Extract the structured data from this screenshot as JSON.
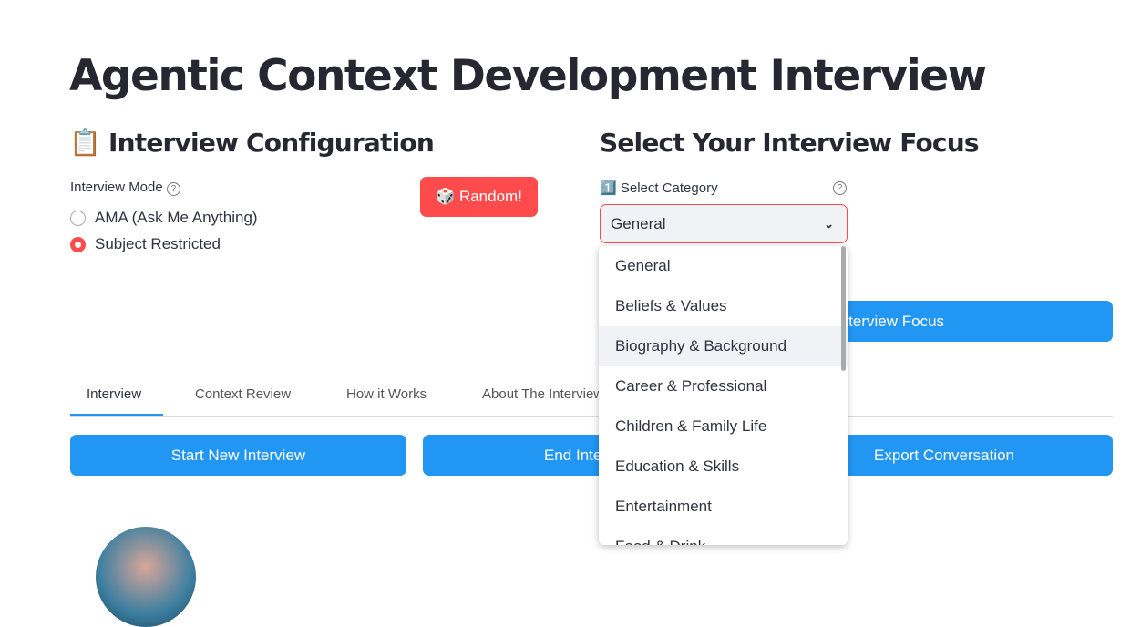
{
  "title": "Agentic Context Development Interview",
  "config": {
    "heading": "Interview Configuration",
    "heading_icon": "clipboard-icon",
    "mode_label": "Interview Mode",
    "modes": [
      "AMA (Ask Me Anything)",
      "Subject Restricted"
    ],
    "selected_mode": "Subject Restricted",
    "random_label": "🎲 Random!"
  },
  "focus": {
    "heading": "Select Your Interview Focus",
    "category_label": "1️⃣ Select Category",
    "selected": "General",
    "options": [
      "General",
      "Beliefs & Values",
      "Biography & Background",
      "Career & Professional",
      "Children & Family Life",
      "Education & Skills",
      "Entertainment",
      "Food & Drink"
    ],
    "highlighted": "Biography & Background",
    "set_button": "Interview Focus"
  },
  "tabs": [
    "Interview",
    "Context Review",
    "How it Works",
    "About The Interview"
  ],
  "active_tab": "Interview",
  "actions": {
    "start": "Start New Interview",
    "end": "End Interview",
    "export": "Export Conversation"
  },
  "colors": {
    "primary": "#2196f3",
    "accent": "#ff4b4b"
  }
}
